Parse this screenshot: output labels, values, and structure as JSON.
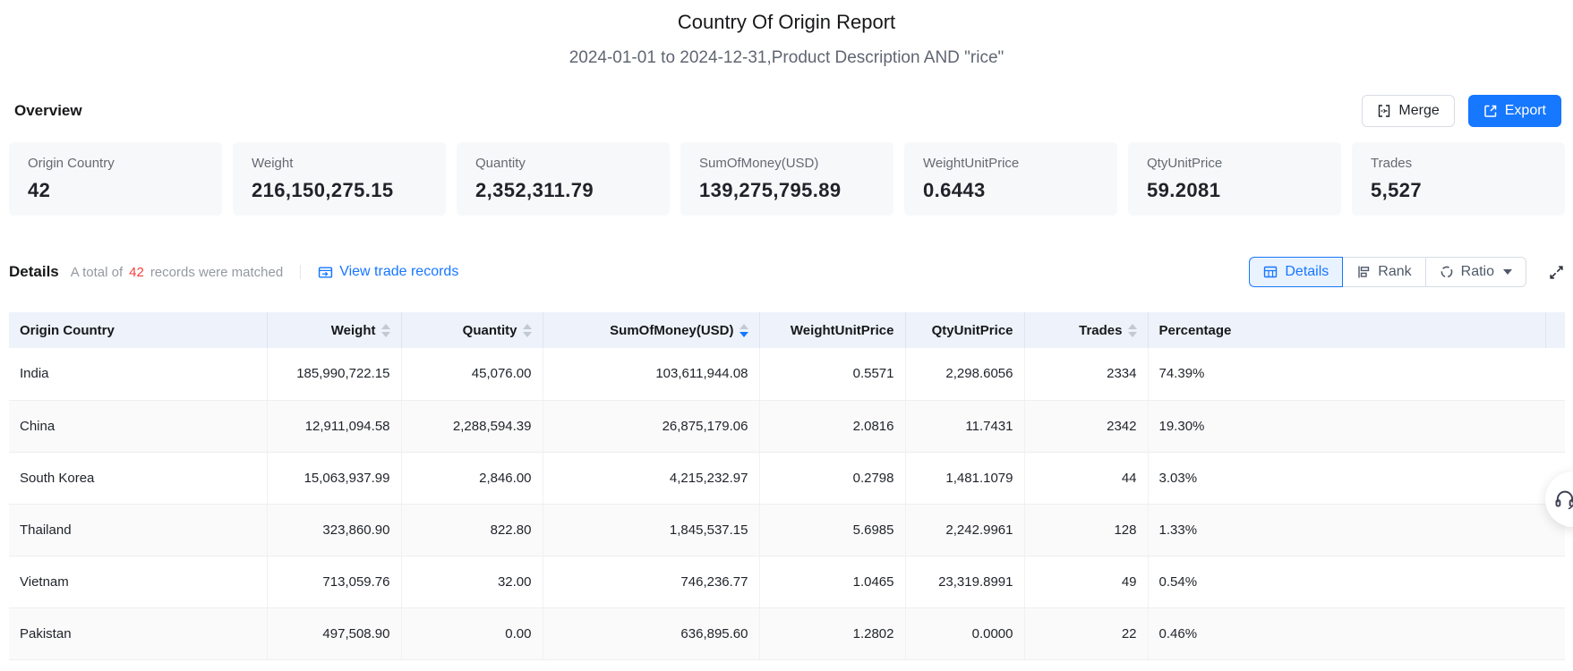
{
  "report": {
    "title": "Country Of Origin Report",
    "subtitle": "2024-01-01 to 2024-12-31,Product Description AND \"rice\""
  },
  "overview": {
    "heading": "Overview",
    "merge_label": "Merge",
    "export_label": "Export",
    "cards": [
      {
        "label": "Origin Country",
        "value": "42"
      },
      {
        "label": "Weight",
        "value": "216,150,275.15"
      },
      {
        "label": "Quantity",
        "value": "2,352,311.79"
      },
      {
        "label": "SumOfMoney(USD)",
        "value": "139,275,795.89"
      },
      {
        "label": "WeightUnitPrice",
        "value": "0.6443"
      },
      {
        "label": "QtyUnitPrice",
        "value": "59.2081"
      },
      {
        "label": "Trades",
        "value": "5,527"
      }
    ]
  },
  "details": {
    "heading": "Details",
    "total_prefix": "A total of",
    "total_count": "42",
    "total_suffix": "records were matched",
    "view_link": "View trade records",
    "tabs": [
      {
        "label": "Details",
        "icon": "table-icon",
        "active": true,
        "dropdown": false
      },
      {
        "label": "Rank",
        "icon": "rank-icon",
        "active": false,
        "dropdown": false
      },
      {
        "label": "Ratio",
        "icon": "ratio-icon",
        "active": false,
        "dropdown": true
      }
    ]
  },
  "table": {
    "columns": [
      {
        "label": "Origin Country",
        "sortable": false,
        "align": "left",
        "sorted": null
      },
      {
        "label": "Weight",
        "sortable": true,
        "align": "right",
        "sorted": null
      },
      {
        "label": "Quantity",
        "sortable": true,
        "align": "right",
        "sorted": null
      },
      {
        "label": "SumOfMoney(USD)",
        "sortable": true,
        "align": "right",
        "sorted": "desc"
      },
      {
        "label": "WeightUnitPrice",
        "sortable": false,
        "align": "right",
        "sorted": null
      },
      {
        "label": "QtyUnitPrice",
        "sortable": false,
        "align": "right",
        "sorted": null
      },
      {
        "label": "Trades",
        "sortable": true,
        "align": "right",
        "sorted": null
      },
      {
        "label": "Percentage",
        "sortable": false,
        "align": "left",
        "sorted": null
      }
    ],
    "rows": [
      [
        "India",
        "185,990,722.15",
        "45,076.00",
        "103,611,944.08",
        "0.5571",
        "2,298.6056",
        "2334",
        "74.39%"
      ],
      [
        "China",
        "12,911,094.58",
        "2,288,594.39",
        "26,875,179.06",
        "2.0816",
        "11.7431",
        "2342",
        "19.30%"
      ],
      [
        "South Korea",
        "15,063,937.99",
        "2,846.00",
        "4,215,232.97",
        "0.2798",
        "1,481.1079",
        "44",
        "3.03%"
      ],
      [
        "Thailand",
        "323,860.90",
        "822.80",
        "1,845,537.15",
        "5.6985",
        "2,242.9961",
        "128",
        "1.33%"
      ],
      [
        "Vietnam",
        "713,059.76",
        "32.00",
        "746,236.77",
        "1.0465",
        "23,319.8991",
        "49",
        "0.54%"
      ],
      [
        "Pakistan",
        "497,508.90",
        "0.00",
        "636,895.60",
        "1.2802",
        "0.0000",
        "22",
        "0.46%"
      ]
    ]
  },
  "colors": {
    "accent": "#1677ff",
    "count_red": "#f53f3f",
    "table_header_bg": "#edf2fb",
    "card_bg": "#f7f8fa"
  }
}
